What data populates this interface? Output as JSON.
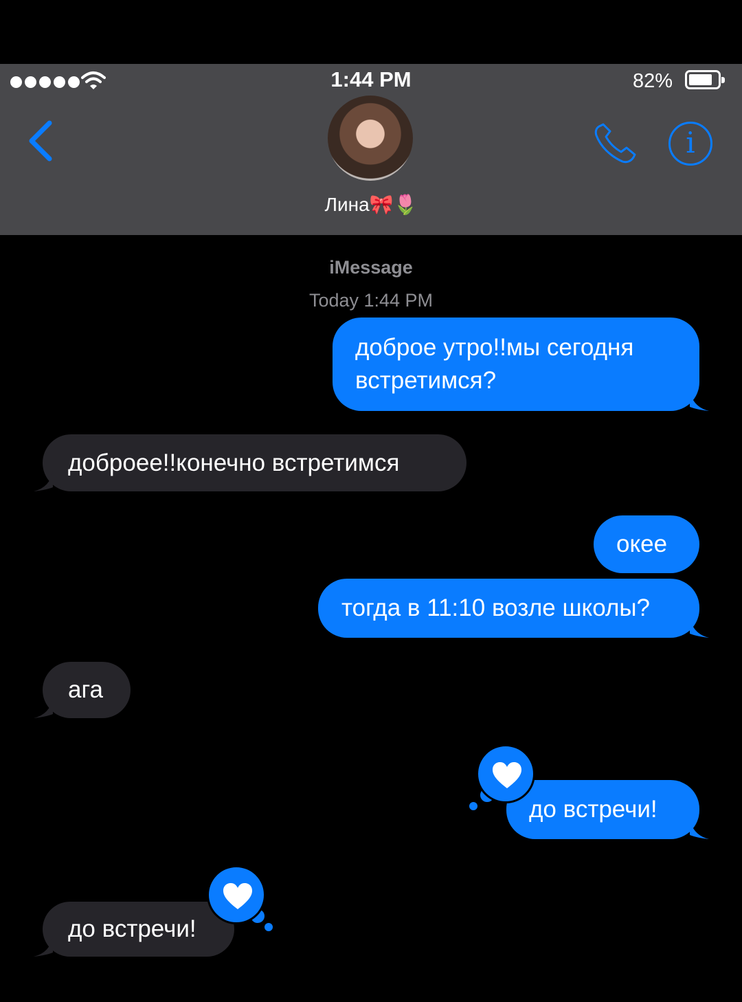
{
  "status_bar": {
    "time": "1:44 PM",
    "battery_percent": "82%",
    "battery_level": 0.82,
    "signal_bars": 5
  },
  "header": {
    "contact_name": "Лина🎀🌷"
  },
  "thread": {
    "service": "iMessage",
    "timestamp": "Today 1:44 PM"
  },
  "messages": [
    {
      "direction": "outgoing",
      "text": "доброе утро!!мы сегодня встретимся?"
    },
    {
      "direction": "incoming",
      "text": "доброее!!конечно встретимся"
    },
    {
      "direction": "outgoing",
      "text": "океe"
    },
    {
      "direction": "outgoing",
      "text": "тогда в 11:10 возле школы?"
    },
    {
      "direction": "incoming",
      "text": "ага"
    },
    {
      "direction": "outgoing",
      "text": "до встречи!",
      "tapback": "heart"
    },
    {
      "direction": "incoming",
      "text": "до встречи!",
      "tapback": "heart"
    }
  ],
  "colors": {
    "outgoing_bubble": "#0a7cff",
    "incoming_bubble": "#26252a",
    "header_bg": "#48484b",
    "accent": "#0a7cff"
  },
  "icons": [
    "back-chevron-icon",
    "phone-icon",
    "info-icon",
    "wifi-icon",
    "heart-icon"
  ]
}
